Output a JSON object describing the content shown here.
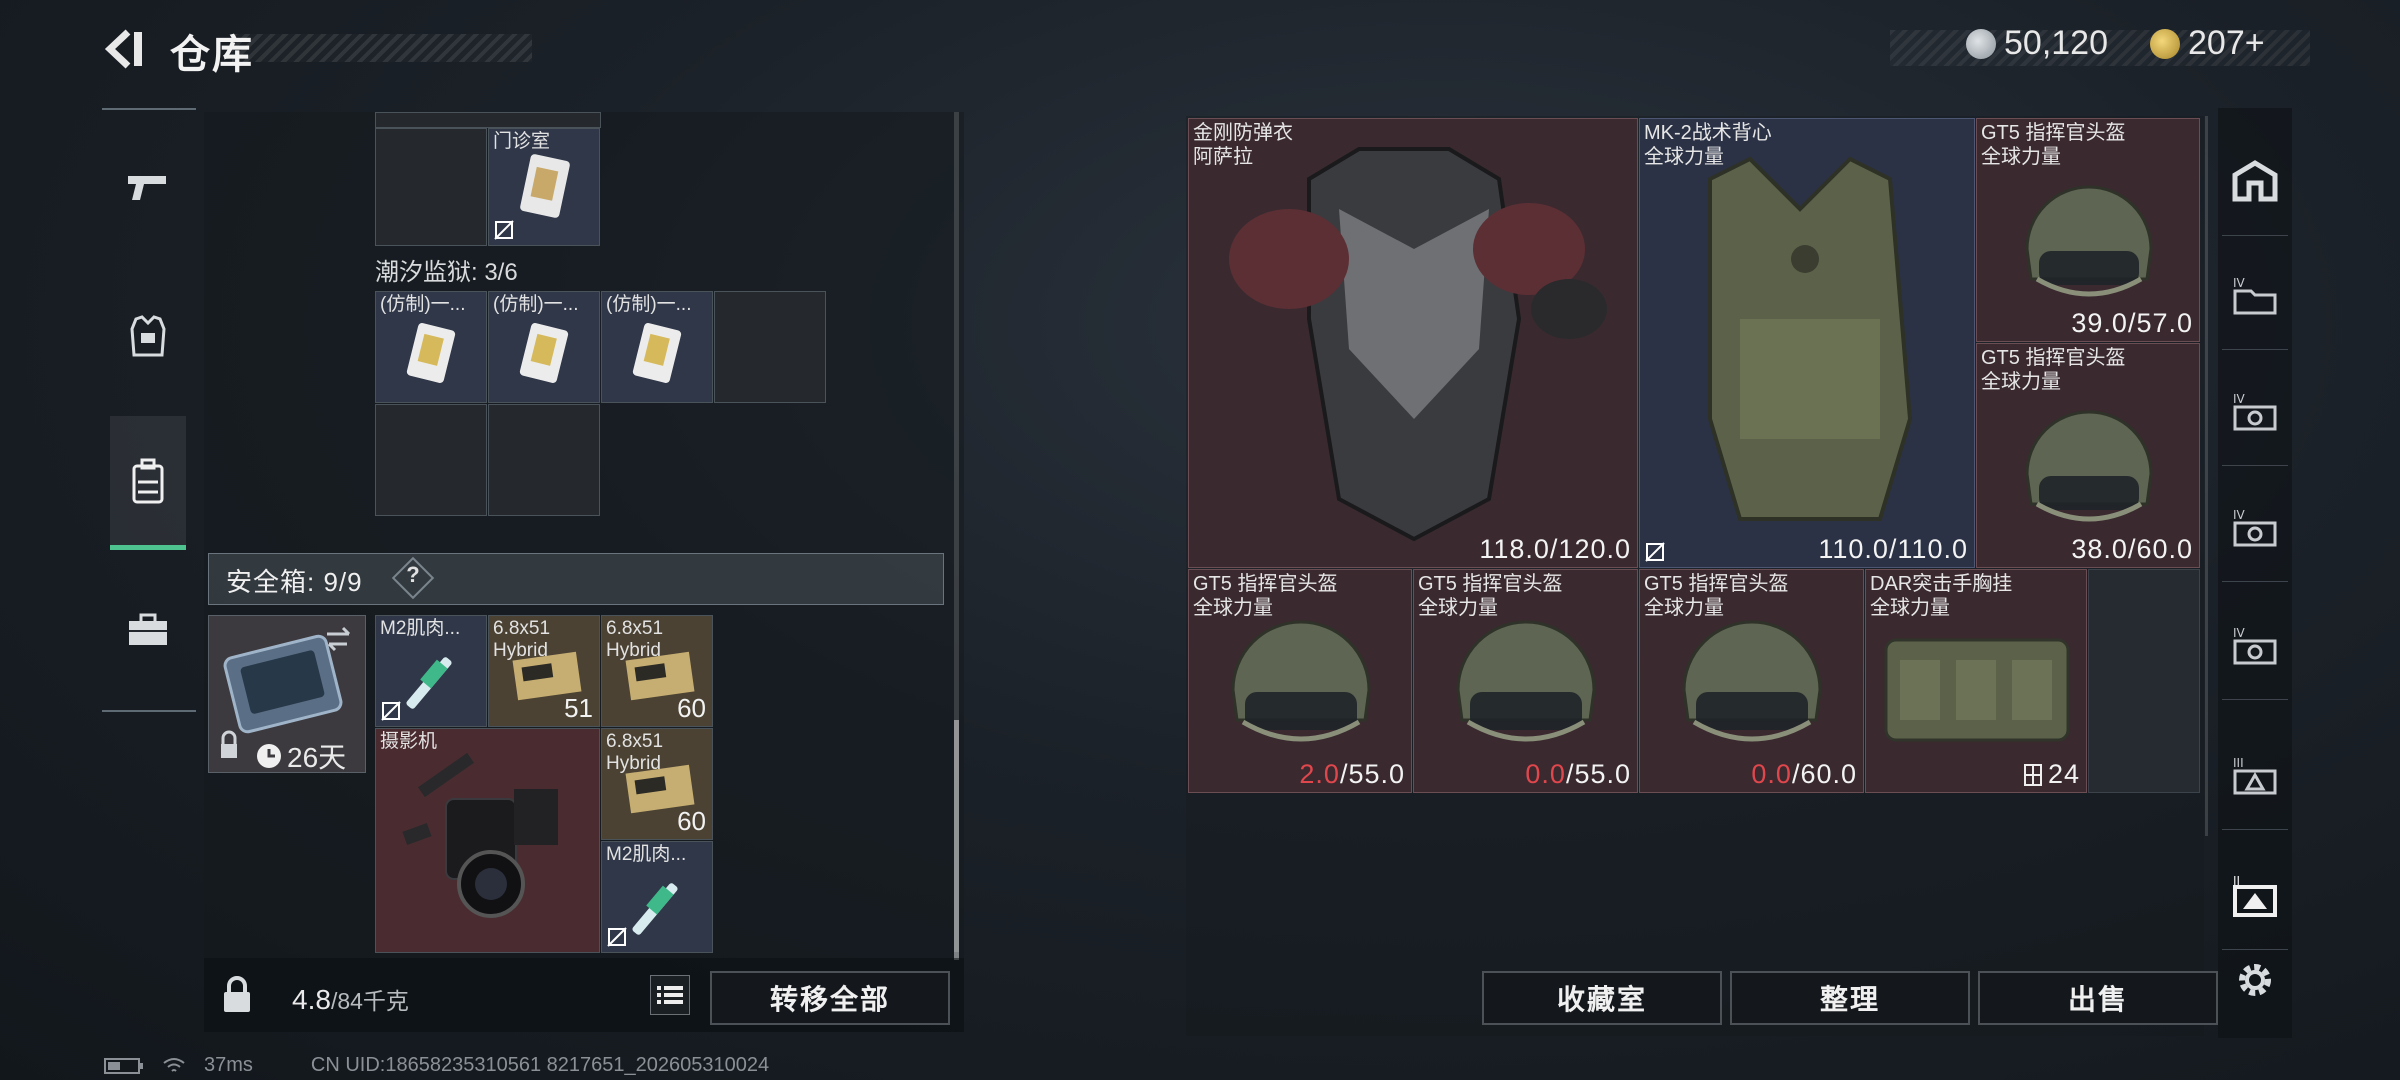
{
  "header": {
    "title": "仓库",
    "currency_silver": "50,120",
    "currency_gold": "207+"
  },
  "left_nav": [
    "firearms",
    "armor",
    "backpack",
    "toolbox"
  ],
  "left_panel": {
    "top_item_label": "门诊室",
    "prison_section": "潮汐监狱: 3/6",
    "prison_items": [
      "(仿制)一...",
      "(仿制)一...",
      "(仿制)一..."
    ],
    "safe_box": "安全箱: 9/9",
    "safe_help": "?",
    "case_days": "26天",
    "safe_items": {
      "m2_top": {
        "label": "M2肌肉..."
      },
      "ammo1": {
        "label": "6.8x51 Hybrid",
        "count": "51"
      },
      "ammo2": {
        "label": "6.8x51 Hybrid",
        "count": "60"
      },
      "camera": {
        "label": "摄影机"
      },
      "ammo3": {
        "label": "6.8x51 Hybrid",
        "count": "60"
      },
      "m2_bottom": {
        "label": "M2肌肉..."
      }
    },
    "weight_current": "4.8",
    "weight_max": "/84千克",
    "transfer_all": "转移全部"
  },
  "right_grid": {
    "armor1": {
      "name": "金刚防弹衣",
      "maker": "阿萨拉",
      "durability": "118.0/120.0"
    },
    "vest": {
      "name": "MK-2战术背心",
      "maker": "全球力量",
      "durability": "110.0/110.0"
    },
    "helmet1": {
      "name": "GT5 指挥官头盔",
      "maker": "全球力量",
      "durability": "39.0/57.0"
    },
    "helmet2": {
      "name": "GT5 指挥官头盔",
      "maker": "全球力量",
      "durability": "38.0/60.0"
    },
    "helmet3": {
      "name": "GT5 指挥官头盔",
      "maker": "全球力量",
      "dur_cur": "2.0",
      "dur_max": "/55.0"
    },
    "helmet4": {
      "name": "GT5 指挥官头盔",
      "maker": "全球力量",
      "dur_cur": "0.0",
      "dur_max": "/55.0"
    },
    "helmet5": {
      "name": "GT5 指挥官头盔",
      "maker": "全球力量",
      "dur_cur": "0.0",
      "dur_max": "/60.0"
    },
    "rig": {
      "name": "DAR突击手胸挂",
      "maker": "全球力量",
      "slots": "24"
    }
  },
  "buttons": {
    "vault": "收藏室",
    "sort": "整理",
    "sell": "出售"
  },
  "right_nav": [
    "home",
    "folder-iv",
    "camera-iv-1",
    "camera-iv-2",
    "camera-iv-3",
    "triangle-iii",
    "frame-ii",
    "settings"
  ],
  "status": {
    "ping": "37ms",
    "uid": "CN UID:18658235310561 8217651_202605310024"
  },
  "colors": {
    "accent_green": "#4fc38f",
    "durability_low": "#e0474d",
    "cell_red": "#4a2c30",
    "cell_blue": "#2f3749"
  }
}
